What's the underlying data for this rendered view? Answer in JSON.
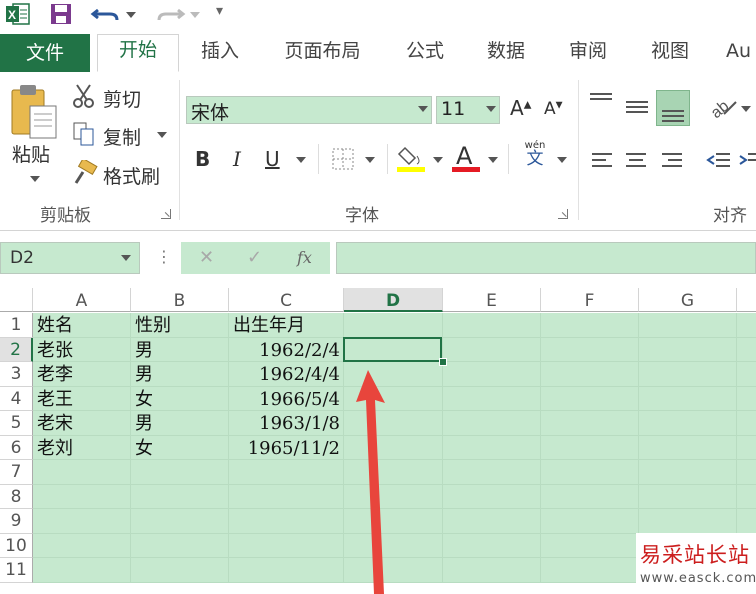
{
  "colors": {
    "accent": "#217346",
    "cell_fill": "#c6e9cf",
    "arrow": "#e8453c",
    "watermark": "#cc1e1e"
  },
  "qat": {
    "customize_label": "▾"
  },
  "tabs": [
    "文件",
    "开始",
    "插入",
    "页面布局",
    "公式",
    "数据",
    "审阅",
    "视图",
    "Au"
  ],
  "active_tab": "开始",
  "ribbon": {
    "clipboard": {
      "paste": "粘贴",
      "cut": "剪切",
      "copy": "复制",
      "format_painter": "格式刷",
      "label": "剪贴板"
    },
    "font": {
      "name": "宋体",
      "size": "11",
      "label": "字体",
      "bold": "B",
      "italic": "I",
      "underline": "U",
      "font_color": "A",
      "grow": "A",
      "shrink": "A",
      "wen_top": "wén",
      "wen": "文"
    },
    "alignment": {
      "label": "对齐"
    }
  },
  "formula_bar": {
    "name_box": "D2",
    "cancel": "✕",
    "enter": "✓",
    "fx": "fx",
    "content": ""
  },
  "sheet": {
    "columns": [
      "A",
      "B",
      "C",
      "D",
      "E",
      "F",
      "G"
    ],
    "selected_column": "D",
    "rows": [
      "1",
      "2",
      "3",
      "4",
      "5",
      "6",
      "7",
      "8",
      "9",
      "10",
      "11"
    ],
    "selected_row": "2",
    "active_cell": "D2",
    "data": [
      [
        "姓名",
        "性别",
        "出生年月"
      ],
      [
        "老张",
        "男",
        "1962/2/4"
      ],
      [
        "老李",
        "男",
        "1962/4/4"
      ],
      [
        "老王",
        "女",
        "1966/5/4"
      ],
      [
        "老宋",
        "男",
        "1963/1/8"
      ],
      [
        "老刘",
        "女",
        "1965/11/2"
      ]
    ]
  },
  "watermark": {
    "title": "易采站长站",
    "url": "www.easck.com"
  }
}
